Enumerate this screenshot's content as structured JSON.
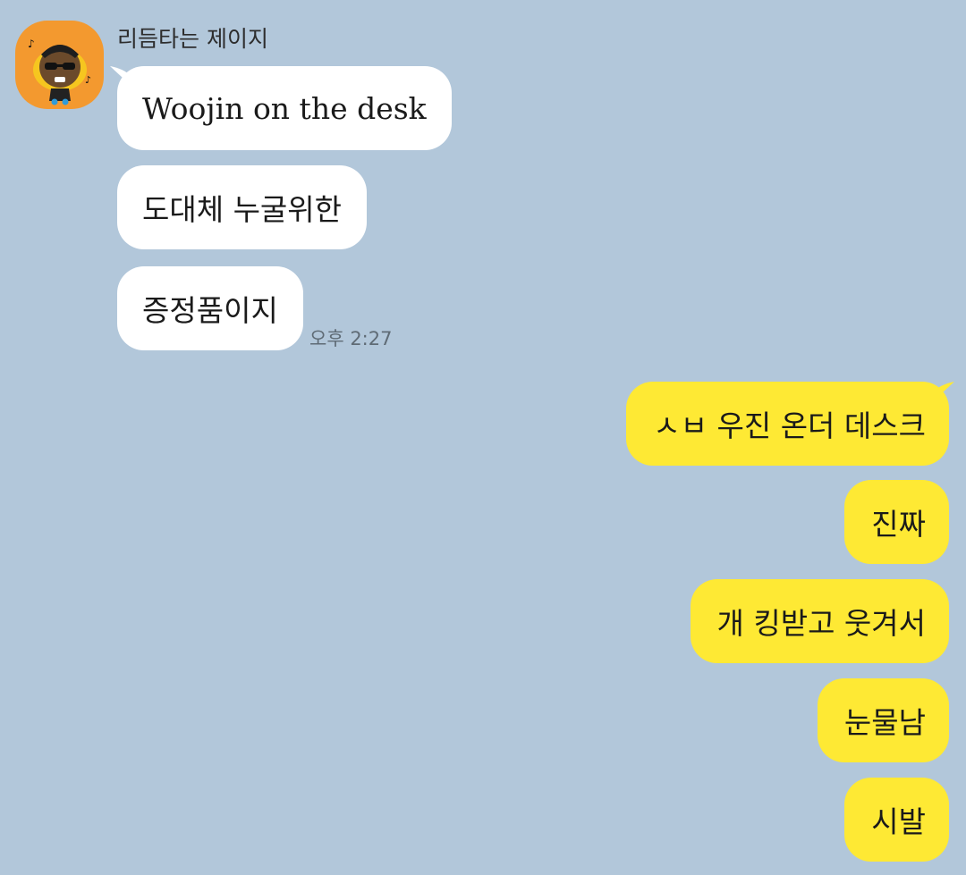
{
  "chat": {
    "sender_name": "리듬타는 제이지",
    "avatar_icon": "character-profile-icon",
    "colors": {
      "background": "#b2c7da",
      "incoming_bubble": "#ffffff",
      "outgoing_bubble": "#fee934",
      "avatar_background": "#f3992f"
    },
    "incoming_messages": [
      {
        "text": "Woojin on the desk"
      },
      {
        "text": "도대체 누굴위한"
      },
      {
        "text": "증정품이지"
      }
    ],
    "incoming_time": "오후 2:27",
    "outgoing_messages": [
      {
        "text": "ㅅㅂ 우진 온더 데스크"
      },
      {
        "text": "진짜"
      },
      {
        "text": "개 킹받고 웃겨서"
      },
      {
        "text": "눈물남"
      },
      {
        "text": "시발"
      }
    ]
  }
}
